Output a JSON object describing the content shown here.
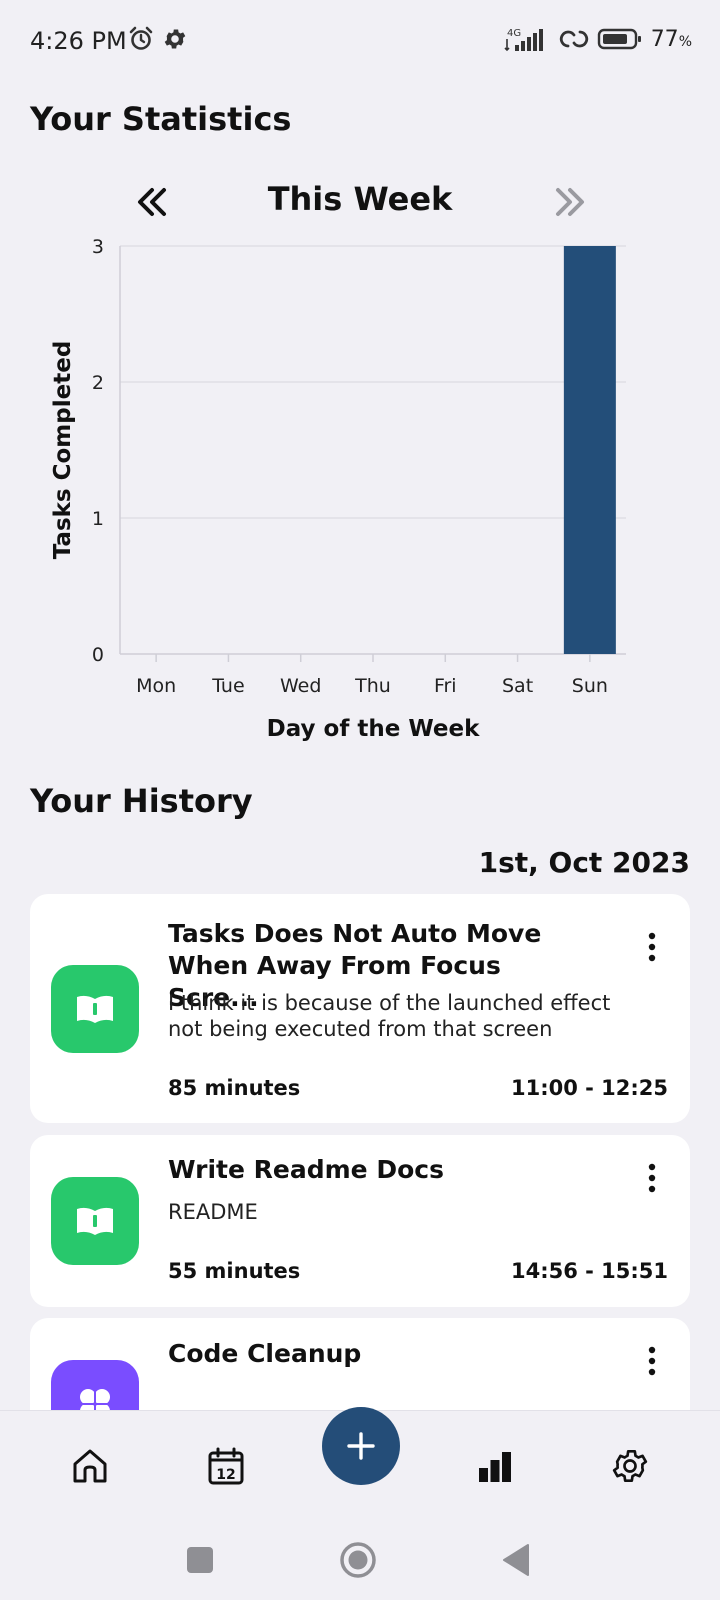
{
  "status_bar": {
    "time": "4:26 PM",
    "network": "4G",
    "battery": "77",
    "battery_unit": "%"
  },
  "statistics": {
    "title": "Your Statistics",
    "period_label": "This Week"
  },
  "chart_data": {
    "type": "bar",
    "categories": [
      "Mon",
      "Tue",
      "Wed",
      "Thu",
      "Fri",
      "Sat",
      "Sun"
    ],
    "values": [
      0,
      0,
      0,
      0,
      0,
      0,
      3
    ],
    "xlabel": "Day of the Week",
    "ylabel": "Tasks Completed",
    "ylim": [
      0,
      3
    ],
    "yticks": [
      "0",
      "1",
      "2",
      "3"
    ],
    "bar_color": "#234e79",
    "grid": true
  },
  "history": {
    "title": "Your History",
    "date": "1st, Oct 2023",
    "items": [
      {
        "title_line1": "Tasks Does Not Auto Move",
        "title_line2": "When Away From Focus Scre...",
        "desc_line1": "I think it is because of the launched effect",
        "desc_line2": "not being executed from that screen",
        "duration": "85 minutes",
        "time_range": "11:00 - 12:25",
        "icon": "book-icon",
        "icon_color": "#28c86c"
      },
      {
        "title": "Write Readme Docs",
        "desc": "README",
        "duration": "55 minutes",
        "time_range": "14:56 - 15:51",
        "icon": "book-icon",
        "icon_color": "#28c86c"
      },
      {
        "title": "Code Cleanup",
        "icon": "flower-icon",
        "icon_color": "#7a4dff"
      }
    ]
  },
  "bottom_nav": {
    "items": [
      "home-icon",
      "calendar-icon",
      "add-icon",
      "stats-icon",
      "settings-icon"
    ],
    "calendar_day": "12",
    "fab_color": "#244d78"
  },
  "system_nav": {
    "items": [
      "recents-button",
      "home-button",
      "back-button"
    ]
  }
}
